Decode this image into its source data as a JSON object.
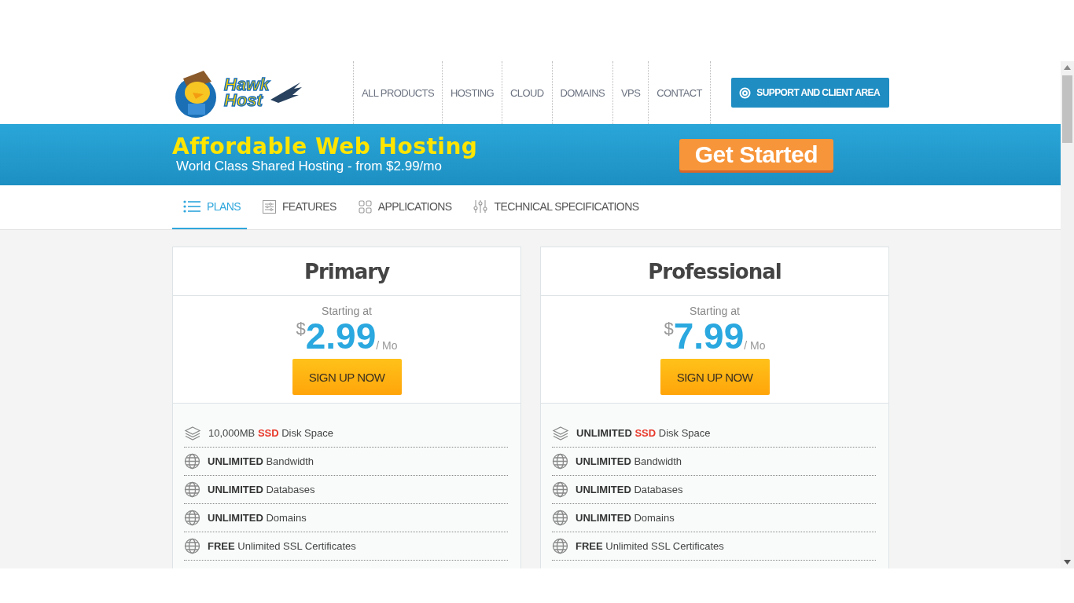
{
  "logo": {
    "text_1": "Hawk",
    "text_2": "Host"
  },
  "nav": {
    "items": [
      {
        "label": "ALL PRODUCTS"
      },
      {
        "label": "HOSTING"
      },
      {
        "label": "CLOUD"
      },
      {
        "label": "DOMAINS"
      },
      {
        "label": "VPS"
      },
      {
        "label": "CONTACT"
      }
    ],
    "support_button": "SUPPORT AND CLIENT AREA"
  },
  "banner": {
    "title": "Affordable Web Hosting",
    "subtitle": "World Class Shared Hosting - from $2.99/mo",
    "button": "Get Started"
  },
  "tabs": [
    {
      "label": "PLANS",
      "kind": "list",
      "selected": true
    },
    {
      "label": "FEATURES",
      "kind": "sliders",
      "selected": false
    },
    {
      "label": "APPLICATIONS",
      "kind": "grid",
      "selected": false
    },
    {
      "label": "TECHNICAL SPECIFICATIONS",
      "kind": "tuning",
      "selected": false
    }
  ],
  "plans": [
    {
      "name": "Primary",
      "starting": "Starting at",
      "currency": "$",
      "price": "2.99",
      "period": "/ Mo",
      "button": "SIGN UP NOW",
      "features": [
        {
          "kind": "layers",
          "parts": [
            {
              "text": "10,000MB ",
              "kind": "plain"
            },
            {
              "text": "SSD",
              "kind": "highlight"
            },
            {
              "text": " Disk Space",
              "kind": "plain"
            }
          ]
        },
        {
          "kind": "globe",
          "parts": [
            {
              "text": "UNLIMITED",
              "kind": "bold"
            },
            {
              "text": " Bandwidth",
              "kind": "plain"
            }
          ]
        },
        {
          "kind": "globe",
          "parts": [
            {
              "text": "UNLIMITED",
              "kind": "bold"
            },
            {
              "text": " Databases",
              "kind": "plain"
            }
          ]
        },
        {
          "kind": "globe",
          "parts": [
            {
              "text": "UNLIMITED",
              "kind": "bold"
            },
            {
              "text": " Domains",
              "kind": "plain"
            }
          ]
        },
        {
          "kind": "globe",
          "parts": [
            {
              "text": "FREE",
              "kind": "bold"
            },
            {
              "text": " Unlimited SSL Certificates",
              "kind": "plain"
            }
          ]
        }
      ]
    },
    {
      "name": "Professional",
      "starting": "Starting at",
      "currency": "$",
      "price": "7.99",
      "period": "/ Mo",
      "button": "SIGN UP NOW",
      "features": [
        {
          "kind": "layers",
          "parts": [
            {
              "text": "UNLIMITED ",
              "kind": "bold"
            },
            {
              "text": "SSD",
              "kind": "highlight"
            },
            {
              "text": " Disk Space",
              "kind": "plain"
            }
          ]
        },
        {
          "kind": "globe",
          "parts": [
            {
              "text": "UNLIMITED",
              "kind": "bold"
            },
            {
              "text": " Bandwidth",
              "kind": "plain"
            }
          ]
        },
        {
          "kind": "globe",
          "parts": [
            {
              "text": "UNLIMITED",
              "kind": "bold"
            },
            {
              "text": " Databases",
              "kind": "plain"
            }
          ]
        },
        {
          "kind": "globe",
          "parts": [
            {
              "text": "UNLIMITED",
              "kind": "bold"
            },
            {
              "text": " Domains",
              "kind": "plain"
            }
          ]
        },
        {
          "kind": "globe",
          "parts": [
            {
              "text": "FREE",
              "kind": "bold"
            },
            {
              "text": " Unlimited SSL Certificates",
              "kind": "plain"
            }
          ]
        }
      ]
    }
  ]
}
